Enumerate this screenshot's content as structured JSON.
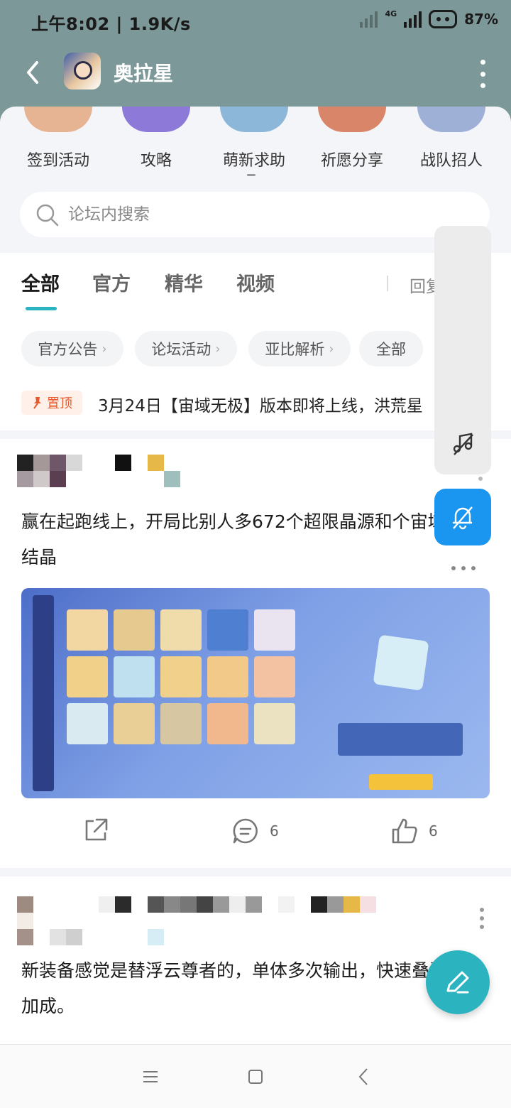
{
  "status_bar": {
    "time": "上午8:02 | 1.9K/s",
    "network": "4G",
    "battery": "87%"
  },
  "header": {
    "title": "奥拉星",
    "icon": "app-avatar-icon"
  },
  "categories": [
    {
      "label": "签到活动",
      "color": "#e6b493"
    },
    {
      "label": "攻略",
      "color": "#8d7ad8"
    },
    {
      "label": "萌新求助",
      "color": "#8db7d8"
    },
    {
      "label": "祈愿分享",
      "color": "#d8856a"
    },
    {
      "label": "战队招人",
      "color": "#9fb0d6"
    }
  ],
  "search": {
    "placeholder": "论坛内搜索"
  },
  "tabs": [
    {
      "label": "全部",
      "active": true
    },
    {
      "label": "官方",
      "active": false
    },
    {
      "label": "精华",
      "active": false
    },
    {
      "label": "视频",
      "active": false
    }
  ],
  "tab_reply": "回复",
  "chips": [
    {
      "label": "官方公告"
    },
    {
      "label": "论坛活动"
    },
    {
      "label": "亚比解析"
    },
    {
      "label": "全部"
    }
  ],
  "pinned": {
    "badge": "置顶",
    "text": "3月24日【宙域无极】版本即将上线，洪荒星"
  },
  "posts": [
    {
      "title": "赢在起跑线上，开局比别人多672个超限晶源和个宙域结晶",
      "comment_count": "6",
      "like_count": "6"
    },
    {
      "title": "新装备感觉是替浮云尊者的，单体多次输出，快速叠满加成。"
    }
  ],
  "colors": {
    "accent": "#2bb3c0",
    "header_bg": "#7d9898",
    "bell_bg": "#1b96f0",
    "pin": "#e85a2b"
  }
}
